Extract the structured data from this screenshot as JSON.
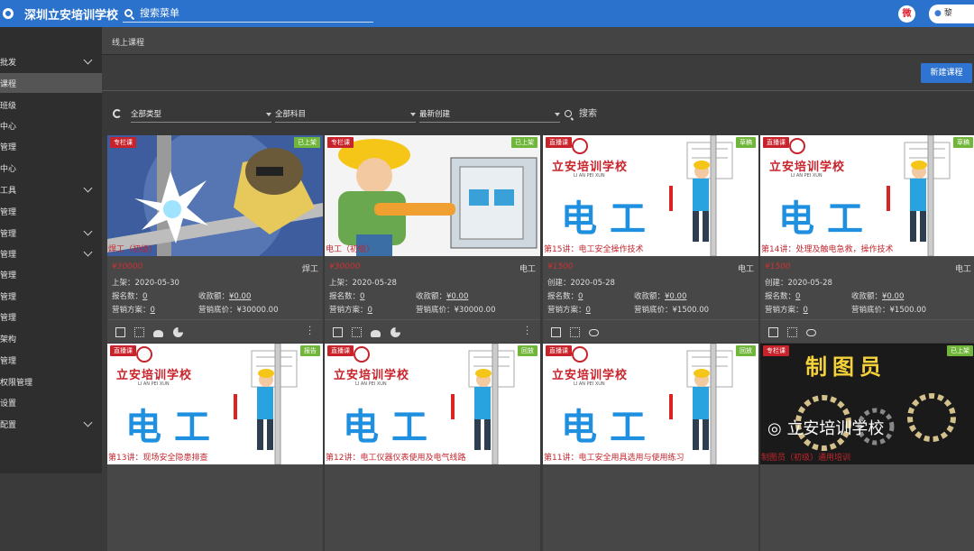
{
  "topbar": {
    "title": "深圳立安培训学校",
    "search_placeholder": "搜索菜单",
    "user": "黎"
  },
  "sidebar": {
    "items": [
      {
        "label": "批发",
        "chevron": true
      },
      {
        "label": "课程",
        "chevron": false,
        "active": true
      },
      {
        "label": "班级",
        "chevron": false
      },
      {
        "label": "中心",
        "chevron": false
      },
      {
        "label": "管理",
        "chevron": false
      },
      {
        "label": "中心",
        "chevron": false
      },
      {
        "label": "工具",
        "chevron": true
      },
      {
        "label": "管理",
        "chevron": false
      },
      {
        "label": "管理",
        "chevron": true
      },
      {
        "label": "管理",
        "chevron": true
      },
      {
        "label": "管理",
        "chevron": false
      },
      {
        "label": "管理",
        "chevron": false
      },
      {
        "label": "管理",
        "chevron": false
      },
      {
        "label": "架构",
        "chevron": false
      },
      {
        "label": "管理",
        "chevron": false
      },
      {
        "label": "权限管理",
        "chevron": false
      },
      {
        "label": "设置",
        "chevron": false
      },
      {
        "label": "配置",
        "chevron": true
      }
    ]
  },
  "breadcrumb": "线上课程",
  "new_button": "新建课程",
  "filters": {
    "type": "全部类型",
    "subject": "全部科目",
    "sort": "最新创建",
    "search": "搜索"
  },
  "labels": {
    "enroll": "报名数：",
    "revenue": "收款额：",
    "plan": "营销方案：",
    "floor": "营销底价："
  },
  "school": {
    "name": "立安培训学校",
    "pinyin": "LI AN PEI XUN",
    "big": "电工"
  },
  "cards": [
    {
      "tag_left": "专栏课",
      "tag_right": "已上架",
      "overlay": "焊工（初级）",
      "price": "¥30000",
      "subject": "焊工",
      "date": "上架：2020-05-30",
      "enroll": "0",
      "revenue": "¥0.00",
      "plan": "0",
      "floor": "¥30000.00"
    },
    {
      "tag_left": "专栏课",
      "tag_right": "已上架",
      "overlay": "电工（初级）",
      "price": "¥30000",
      "subject": "电工",
      "date": "上架：2020-05-28",
      "enroll": "0",
      "revenue": "¥0.00",
      "plan": "0",
      "floor": "¥30000.00"
    },
    {
      "tag_left": "直播课",
      "tag_right": "草稿",
      "overlay": "第15讲：电工安全操作技术",
      "price": "¥1500",
      "subject": "电工",
      "date": "创建：2020-05-28",
      "enroll": "0",
      "revenue": "¥0.00",
      "plan": "0",
      "floor": "¥1500.00"
    },
    {
      "tag_left": "直播课",
      "tag_right": "草稿",
      "overlay": "第14讲：处理及触电急救，操作技术",
      "price": "¥1500",
      "subject": "电工",
      "date": "创建：2020-05-28",
      "enroll": "0",
      "revenue": "¥0.00",
      "plan": "0",
      "floor": "¥1500.00"
    },
    {
      "tag_left": "直播课",
      "tag_right": "报告",
      "overlay": "第13讲：现场安全隐患排查"
    },
    {
      "tag_left": "直播课",
      "tag_right": "回放",
      "overlay": "第12讲：电工仪器仪表使用及电气线路"
    },
    {
      "tag_left": "直播课",
      "tag_right": "回放",
      "overlay": "第11讲：电工安全用具选用与使用练习"
    },
    {
      "tag_left": "专栏课",
      "tag_right": "已上架",
      "overlay": "制图员（初级）通用培训",
      "big": "制图员",
      "watermark": "立安培训学校"
    }
  ],
  "colors": {
    "topbar": "#2a72cc",
    "tag_red": "#c8222a",
    "tag_green": "#6fb63a",
    "price": "#cc3333",
    "electric_blue": "#1f8fe0"
  }
}
